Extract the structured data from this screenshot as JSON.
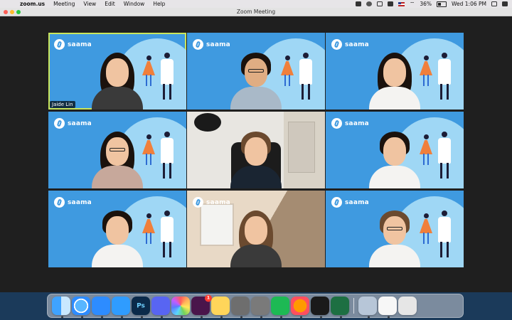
{
  "menubar": {
    "app_name": "zoom.us",
    "menus": [
      "Meeting",
      "View",
      "Edit",
      "Window",
      "Help"
    ],
    "battery_percent": "36%",
    "clock": "Wed 1:06 PM"
  },
  "window": {
    "title": "Zoom Meeting"
  },
  "tiles": [
    {
      "logo_text": "saama",
      "name_label": "Jaide Lin"
    },
    {
      "logo_text": "saama"
    },
    {
      "logo_text": "saama"
    },
    {
      "logo_text": "saama"
    },
    {},
    {
      "logo_text": "saama"
    },
    {
      "logo_text": "saama"
    },
    {
      "logo_text": "saama"
    },
    {
      "logo_text": "saama"
    }
  ],
  "dock": {
    "items": [
      {
        "label": "Finder"
      },
      {
        "label": "Safari"
      },
      {
        "label": "Zoom"
      },
      {
        "label": "Messages"
      },
      {
        "label": "Ps"
      },
      {
        "label": "Discord"
      },
      {
        "label": "Photos"
      },
      {
        "label": "Slack",
        "badge": "1"
      },
      {
        "label": "Notes"
      },
      {
        "label": "Launchpad"
      },
      {
        "label": "System Preferences"
      },
      {
        "label": "Spotify"
      },
      {
        "label": "Firefox"
      },
      {
        "label": "Acrobat"
      },
      {
        "label": "Excel"
      },
      {
        "label": "Preview"
      },
      {
        "label": "Document"
      },
      {
        "label": "Trash"
      }
    ]
  },
  "colors": {
    "accent_active_speaker": "#c9e55b",
    "tile_blue": "#3f9ae0"
  }
}
